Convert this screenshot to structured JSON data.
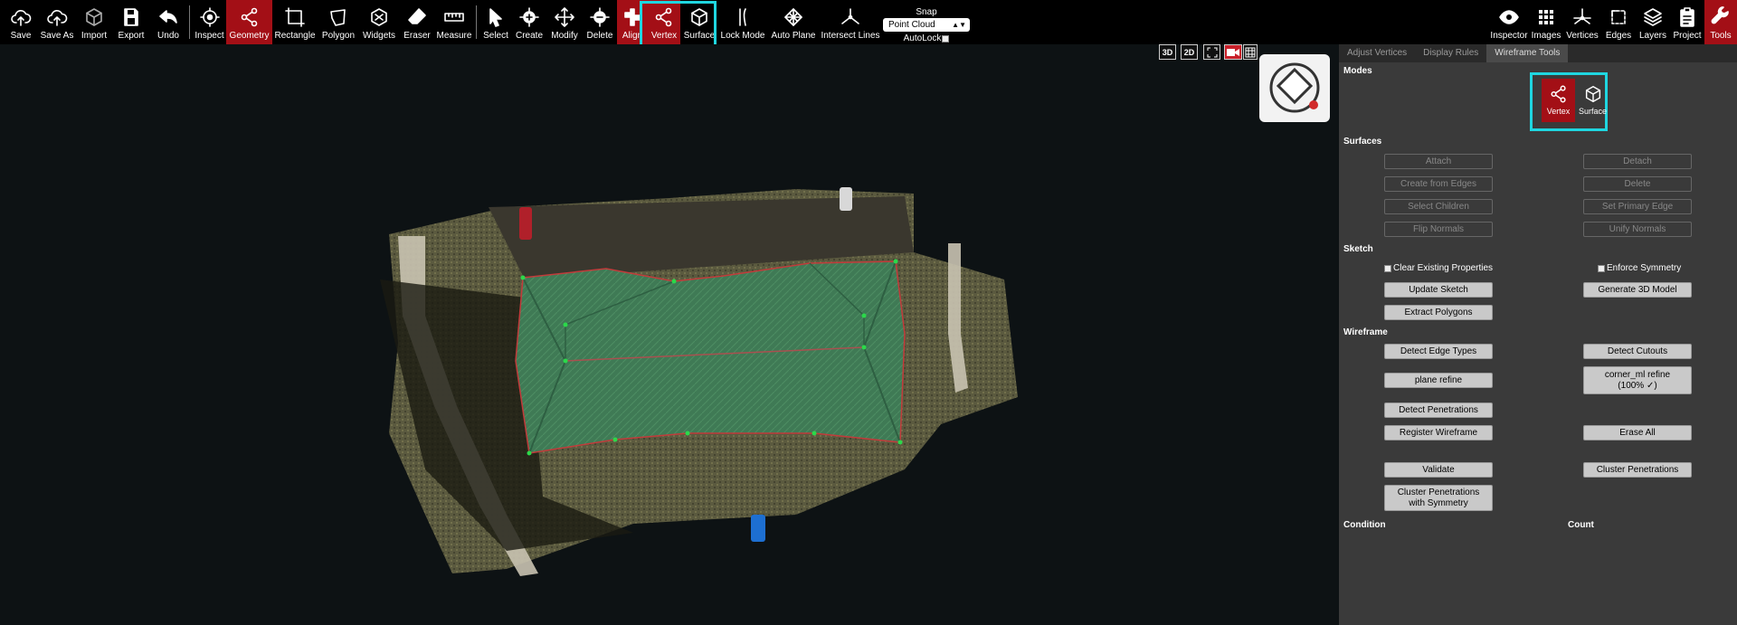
{
  "toolbar": {
    "left_items": [
      {
        "label": "Save",
        "icon": "cloud-upload-icon"
      },
      {
        "label": "Save As",
        "icon": "cloud-upload-icon"
      },
      {
        "label": "Import",
        "icon": "cube-icon"
      },
      {
        "label": "Export",
        "icon": "floppy-disk-icon"
      },
      {
        "label": "Undo",
        "icon": "undo-icon"
      }
    ],
    "geometry_items": [
      {
        "label": "Inspect",
        "icon": "crosshair-icon"
      },
      {
        "label": "Geometry",
        "icon": "share-nodes-icon",
        "active": true
      },
      {
        "label": "Rectangle",
        "icon": "rectangle-icon"
      },
      {
        "label": "Polygon",
        "icon": "polygon-icon"
      },
      {
        "label": "Widgets",
        "icon": "widgets-icon"
      },
      {
        "label": "Eraser",
        "icon": "eraser-icon"
      },
      {
        "label": "Measure",
        "icon": "ruler-icon"
      }
    ],
    "edit_items": [
      {
        "label": "Select",
        "icon": "pointer-icon"
      },
      {
        "label": "Create",
        "icon": "plus-circle-icon"
      },
      {
        "label": "Modify",
        "icon": "move-arrows-icon"
      },
      {
        "label": "Delete",
        "icon": "minus-circle-icon"
      },
      {
        "label": "Align",
        "icon": "align-icon",
        "active": true
      },
      {
        "label": "Vertex",
        "icon": "share-nodes-icon",
        "active": true
      },
      {
        "label": "Surface",
        "icon": "cube-icon"
      },
      {
        "label": "Lock Mode",
        "icon": "lock-mode-icon"
      },
      {
        "label": "Auto Plane",
        "icon": "grid-diamond-icon"
      },
      {
        "label": "Intersect Lines",
        "icon": "intersect-icon"
      }
    ],
    "snap": {
      "title": "Snap",
      "selected": "Point Cloud",
      "autolock_label": "AutoLock"
    },
    "right_items": [
      {
        "label": "Inspector",
        "icon": "eye-icon"
      },
      {
        "label": "Images",
        "icon": "grid-dots-icon"
      },
      {
        "label": "Vertices",
        "icon": "axes-icon"
      },
      {
        "label": "Edges",
        "icon": "edges-icon"
      },
      {
        "label": "Layers",
        "icon": "layers-icon"
      },
      {
        "label": "Project",
        "icon": "clipboard-icon"
      },
      {
        "label": "Tools",
        "icon": "wrench-icon",
        "active": true
      }
    ]
  },
  "viewport": {
    "controls": [
      "3D",
      "2D"
    ]
  },
  "panel": {
    "tabs": [
      {
        "label": "Adjust Vertices",
        "active": false
      },
      {
        "label": "Display Rules",
        "active": false
      },
      {
        "label": "Wireframe Tools",
        "active": true
      }
    ],
    "modes_title": "Modes",
    "modes": [
      {
        "label": "Vertex",
        "icon": "share-nodes-icon",
        "active": true
      },
      {
        "label": "Surface",
        "icon": "cube-icon",
        "active": false
      }
    ],
    "surfaces_title": "Surfaces",
    "surfaces_buttons": {
      "attach": "Attach",
      "detach": "Detach",
      "create_from_edges": "Create from Edges",
      "delete": "Delete",
      "select_children": "Select Children",
      "set_primary_edge": "Set Primary Edge",
      "flip_normals": "Flip Normals",
      "unify_normals": "Unify Normals"
    },
    "sketch_title": "Sketch",
    "sketch": {
      "clear_existing": "Clear Existing Properties",
      "enforce_symmetry": "Enforce Symmetry",
      "update_sketch": "Update Sketch",
      "generate_3d": "Generate 3D Model",
      "extract_polygons": "Extract Polygons"
    },
    "wireframe_title": "Wireframe",
    "wireframe": {
      "detect_edge_types": "Detect Edge Types",
      "detect_cutouts": "Detect Cutouts",
      "plane_refine": "plane refine",
      "corner_ml_refine": "corner_ml refine (100% ✓)",
      "detect_penetrations": "Detect Penetrations",
      "register_wireframe": "Register Wireframe",
      "erase_all": "Erase All",
      "validate": "Validate",
      "cluster_penetrations": "Cluster Penetrations",
      "cluster_penetrations_symmetry": "Cluster Penetrations with Symmetry"
    },
    "condition_label": "Condition",
    "count_label": "Count"
  },
  "colors": {
    "active_red": "#a30f16",
    "highlight_cyan": "#1fd6e0",
    "toolbar_bg": "#000000",
    "panel_bg": "#3a3a3a",
    "viewport_bg": "#0d1214"
  }
}
